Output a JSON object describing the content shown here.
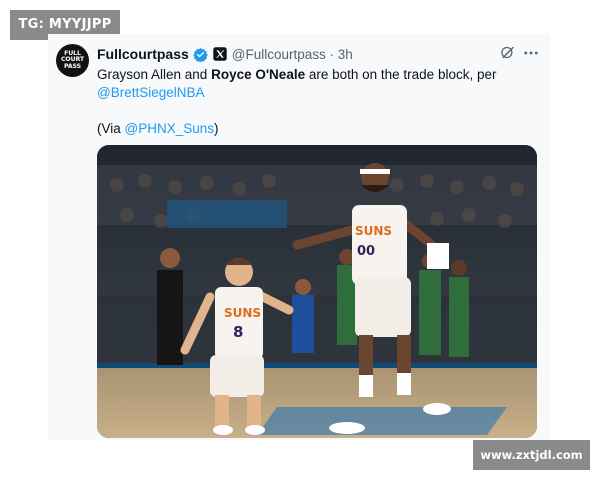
{
  "overlay_tag": "TG: MYYJJPP",
  "watermark": "www.zxtjdl.com",
  "tweet": {
    "avatar_lines": [
      "FULL",
      "COURT",
      "PASS"
    ],
    "display_name": "Fullcourtpass",
    "handle_time": "@Fullcourtpass · 3h",
    "text_1": "Grayson Allen and ",
    "text_bold": "Royce O'Neale",
    "text_2": " are both on the trade block, per",
    "mention": "@BrettSiegelNBA",
    "via_open": "(Via ",
    "via_mention": "@PHNX_Suns",
    "via_close": ")"
  },
  "photo": {
    "left_player_jersey_team": "SUNS",
    "left_player_number": "8",
    "right_player_jersey_team": "SUNS",
    "right_player_number": "00"
  },
  "colors": {
    "link": "#1d9bf0",
    "verified": "#1d9bf0",
    "card_bg": "#f7f9fb",
    "watermark_bg": "#8a8a8a"
  },
  "icons": [
    "verified-icon",
    "x-logo-icon",
    "grok-icon",
    "more-icon"
  ]
}
